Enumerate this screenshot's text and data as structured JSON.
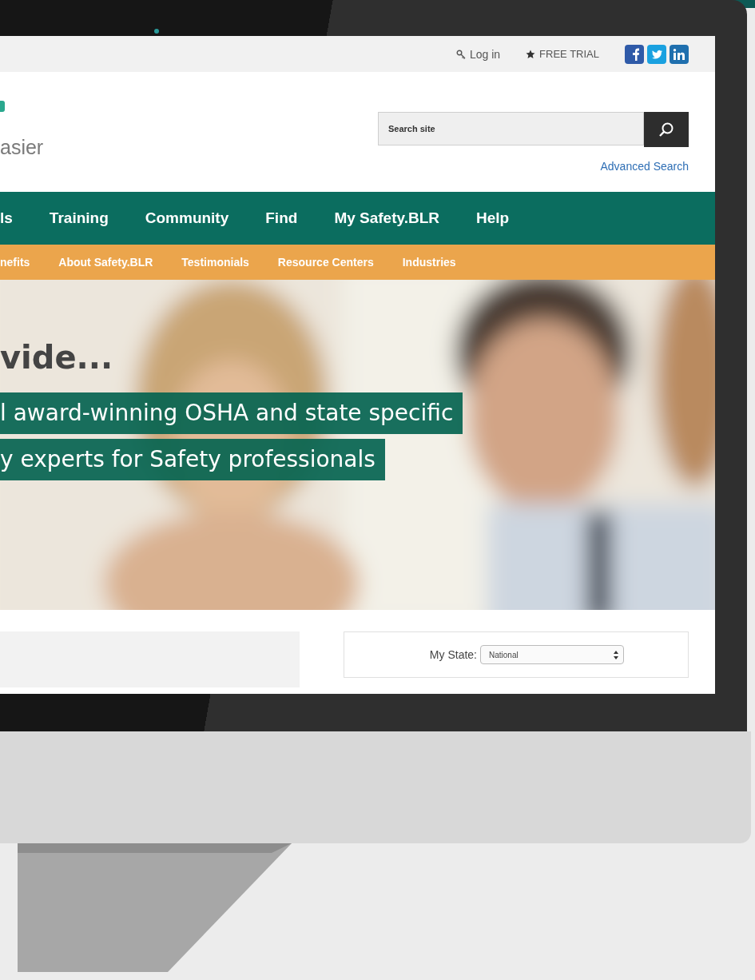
{
  "top_bar": {
    "links": [
      {
        "kind": "login",
        "label": "Log in"
      },
      {
        "kind": "trial",
        "label": "FREE TRIAL"
      }
    ],
    "social": [
      {
        "kind": "facebook"
      },
      {
        "kind": "twitter"
      },
      {
        "kind": "linkedin"
      }
    ]
  },
  "header": {
    "tagline": "asier",
    "search": {
      "placeholder": "Search site"
    },
    "advanced_search": "Advanced Search"
  },
  "main_nav": [
    "ls",
    "Training",
    "Community",
    "Find",
    "My Safety.BLR",
    "Help"
  ],
  "sub_nav": [
    "nefits",
    "About Safety.BLR",
    "Testimonials",
    "Resource Centers",
    "Industries"
  ],
  "hero": {
    "heading": "vide...",
    "highlight_lines": [
      "l award-winning OSHA and state specific",
      "y experts for Safety professionals"
    ]
  },
  "state_selector": {
    "label": "My State:",
    "value": "National"
  }
}
